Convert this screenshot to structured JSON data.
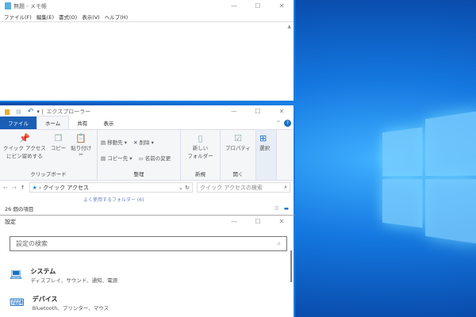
{
  "notepad": {
    "title": "無題 - メモ帳",
    "menu": [
      "ファイル(F)",
      "編集(E)",
      "書式(O)",
      "表示(V)",
      "ヘルプ(H)"
    ]
  },
  "explorer": {
    "title": "エクスプローラー",
    "tabs": [
      "ファイル",
      "ホーム",
      "共有",
      "表示"
    ],
    "ribbon": {
      "pin": "クイック アクセス\nにピン留めする",
      "copy": "コピー",
      "paste": "貼り付け",
      "clipboard": "クリップボード",
      "move_to": "移動先",
      "copy_to": "コピー先",
      "delete": "削除",
      "rename": "名前の変更",
      "organize": "整理",
      "new_folder": "新しい\nフォルダー",
      "new": "新規",
      "properties": "プロパティ",
      "open": "開く",
      "select": "選択"
    },
    "address": "クイック アクセス",
    "search_placeholder": "クイック アクセスの検索",
    "partial_item": "よく使用するフォルダー (6)",
    "status": "26 個の項目"
  },
  "settings": {
    "title": "設定",
    "search_placeholder": "設定の検索",
    "items": [
      {
        "title": "システム",
        "desc": "ディスプレイ、サウンド、通知、電源"
      },
      {
        "title": "デバイス",
        "desc": "Bluetooth、プリンター、マウス"
      }
    ]
  },
  "colors": {
    "accent": "#1a6fc4",
    "desktop": "#0a4fb0"
  }
}
